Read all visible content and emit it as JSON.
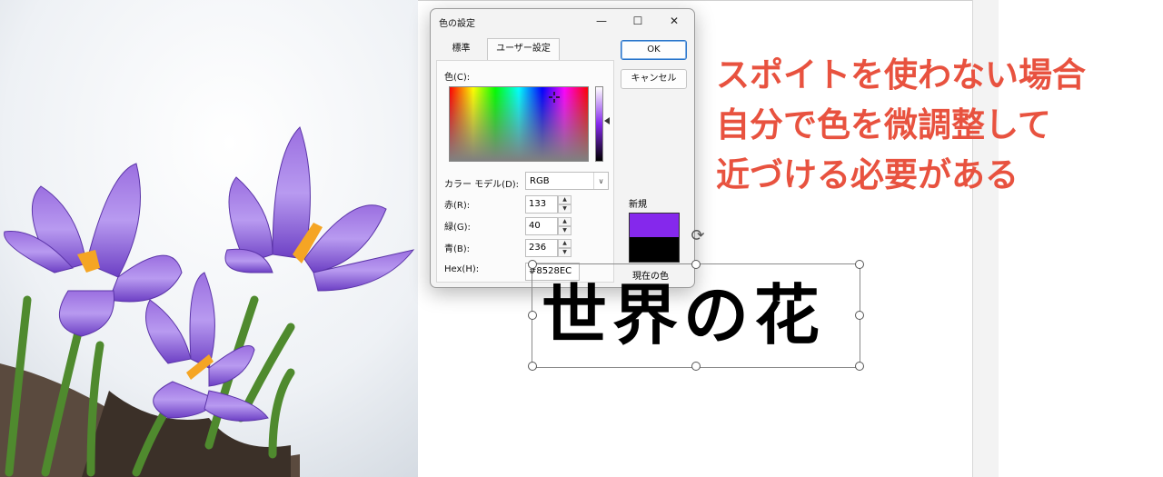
{
  "dialog": {
    "title": "色の設定",
    "minimize": "—",
    "maximize": "☐",
    "close": "✕",
    "tabs": [
      "標準",
      "ユーザー設定"
    ],
    "color_label": "色(C):",
    "color_model_label": "カラー モデル(D):",
    "color_model_value": "RGB",
    "red_label": "赤(R):",
    "red_value": "133",
    "green_label": "緑(G):",
    "green_value": "40",
    "blue_label": "青(B):",
    "blue_value": "236",
    "hex_label": "Hex(H):",
    "hex_value": "#8528EC",
    "ok": "OK",
    "cancel": "キャンセル",
    "new_label": "新規",
    "current_label": "現在の色",
    "new_color": "#8528EC",
    "current_color": "#000000"
  },
  "slide": {
    "title_text": "世界の花"
  },
  "annotation": {
    "lines": [
      "スポイトを使わない場合",
      "自分で色を微調整して",
      "近づける必要がある"
    ],
    "color": "#E8523F"
  },
  "icons": {
    "rotate": "rotate-handle-icon",
    "crosshair": "crosshair-icon",
    "spin_up": "chevron-up-icon",
    "spin_down": "chevron-down-icon"
  }
}
